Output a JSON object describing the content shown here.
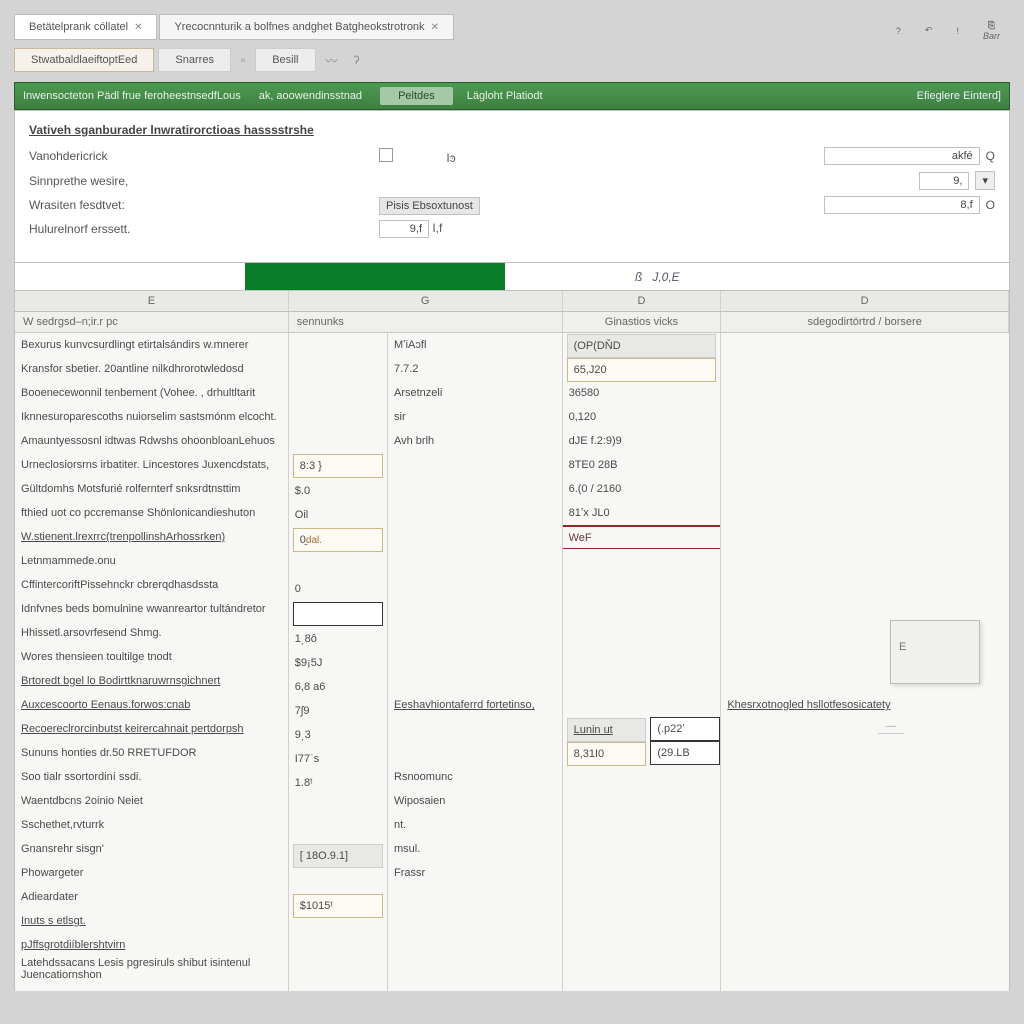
{
  "tabs": [
    {
      "label": "Betätelprank cóllatel",
      "close": "✕"
    },
    {
      "label": "Yrecocnnturik a bolfnes andghet Batgheokstrotronk",
      "close": "✕"
    }
  ],
  "titlebar_icons": [
    "?",
    "↶",
    "!",
    "⎘"
  ],
  "titlebar_sub": "Barr",
  "toolbar": [
    "StwatbaldlaeiftoptEed",
    "Snarres",
    "Besill"
  ],
  "greenbar": {
    "items": [
      "Inwensocteton Pädl frue feroheestnsedfLous",
      "ak, aoowendinsstnad"
    ],
    "button": "Peltdes",
    "mid": "Lägloht Platiodt",
    "right": "Efieglere Einterd]"
  },
  "form": {
    "title": "Vativeh sganburader lnwratirorctioas hasssstrshe",
    "rows": [
      {
        "label": "Vanohdericrick",
        "ctl_type": "check",
        "ctl_after": "Iͽ",
        "right": {
          "inp": "akfé",
          "after": "Q"
        }
      },
      {
        "label": "Sinnprethe wesire,",
        "right": {
          "inp": "9,",
          "stepper": true
        }
      },
      {
        "label": "Wrasiten fesdtvet:",
        "ctl_type": "greybtn",
        "ctl_text": "Pisis Ebsoxtunost",
        "right": {
          "inp": "8,f",
          "after": "O"
        }
      },
      {
        "label": "Hulurelnorf erssett.",
        "ctl_type": "inp",
        "ctl_text": "9,f",
        "ctl_after": "I,f"
      }
    ]
  },
  "underbar": {
    "mid_a": "ß",
    "mid_b": "J,0,E"
  },
  "columns": [
    "E",
    "G",
    "D",
    "D"
  ],
  "subheaders": [
    "W sedrgsd–n;ir.r pc",
    "sennunks",
    "Ginastios vicks",
    "sdegodirtörtrd / borsere"
  ],
  "gridA": [
    "Bexurus kunvcsurdlingt etirtalsándirs w.mnerer",
    "Kransfor sbetier. 20antline nilkdhrorotwledosd",
    "Booenecewonnil tenbement (Vohee. , drhultltarit",
    "Iknnesuroparescoths nuiorselim sastsmónm elcocht.",
    "Amauntyessosnl idtwas Rdwshs ohoonbloanLehuos",
    "Urneclosiorsrns irbatiter. Lincestores Juxencdstats,",
    "Gültdomhs Motsfurié rolfernterf snksrdtnsttim",
    "fthied uot co pccremanse Shönlonicandieshuton",
    "W.stienent.lrexrrc(trenpollinshArhossrken)",
    "Letnmammede.onu",
    "CffintercoriftPissehnckr cbrerqdhasdssta",
    "Idnfvnes beds bomulnine wwanreartor tultándretor",
    "Hhissetl.arsovrfesend Shmg.",
    "Wores thensieen toultilge tnodt",
    "Brtoredt bgel lo Bodirttknaruwrnsgichnert",
    "Auxcescoorto Eenaus.forwos:cnab",
    "Recoereclrorcinbutst keirercahnait pertdorpsh",
    "Sununs honties dr.50 RRETUFDOR",
    "Soo tialr ssortordiní ssdi.",
    "Waentdbcns 2oinio Neiet",
    "Sschethet,rvturrk",
    "Gnansrehr sisgn'",
    "Phowargeter",
    "Adieardater",
    "Inuts s etlsgt.",
    "pJffsgrotdiíblershtvirn",
    "Latehdssacans Lesis pgresiruls shibut isintenul Juencatiornshon"
  ],
  "gridA_underline": [
    8,
    14,
    15,
    16,
    24,
    25
  ],
  "gridB": [
    "",
    "",
    "",
    "",
    "",
    "8:3 }",
    "$.0",
    "Oil",
    "0̱",
    "",
    "0",
    "",
    "1͵8ô",
    "$9¡5J",
    "6,8 a6",
    "7ʃ9",
    "9͵3",
    "I77ˈs",
    "1.8ᵗ",
    "",
    "",
    "[ 18O.9.1]",
    "",
    "$1015ᵗ",
    "",
    "",
    ""
  ],
  "gridB_box": {
    "5": "box",
    "8": "box",
    "11": "box darkbox",
    "21": "greybox",
    "23": "box"
  },
  "gridB_extra": {
    "8": "dal."
  },
  "gridC": [
    "MʼiAɔfl",
    "7.7.2",
    "Arsetnzeli",
    "sir",
    "Avh brlh",
    "",
    "",
    "",
    "",
    "",
    "",
    "",
    "",
    "",
    "",
    "",
    "",
    "",
    "Rsnoomunc",
    "Wiposaien",
    "nt.",
    "msul.",
    "Frassr",
    "",
    "",
    "",
    ""
  ],
  "gridC_sub": {
    "15": "Eeshavhiontaferrd fortetinso,"
  },
  "gridD": [
    "(OP(DŇD",
    "65,J20",
    "36580",
    "0,120",
    "dJE f.2:9)9",
    "8TE0 28B",
    "6.(0 / 2160",
    "81ʼx JL0",
    "WeF",
    "",
    "",
    "",
    "",
    "",
    "",
    "",
    "Lunin ut",
    "8,31I0",
    "",
    "",
    "",
    "",
    "",
    "",
    "",
    "",
    ""
  ],
  "gridD_style": {
    "0": "greybox",
    "1": "box",
    "8": "redline",
    "16": "greybox u",
    "17": "box"
  },
  "gridD2": {
    "16": "(.p22ʼ",
    "17": "(29.LB"
  },
  "gridE": {
    "15": "Khesrxotnogled hsllotfesosicatety"
  },
  "popup": "E",
  "smalltag": "—"
}
